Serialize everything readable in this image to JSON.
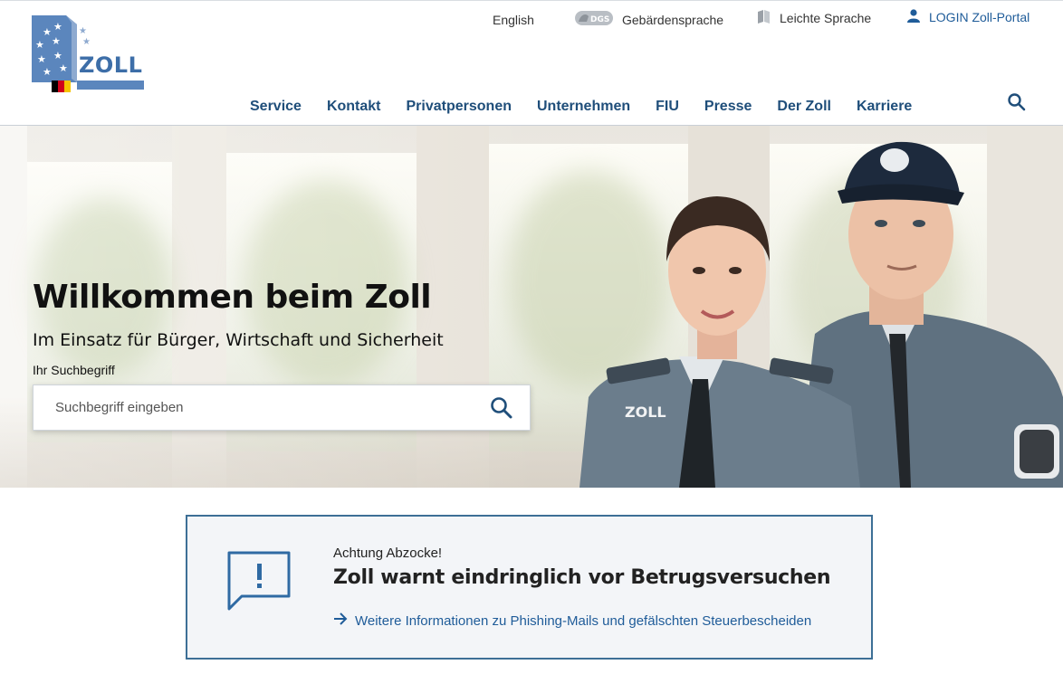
{
  "header": {
    "logo_text": "ZOLL",
    "meta": {
      "language": "English",
      "sign_language_badge": "DGS",
      "sign_language": "Gebärdensprache",
      "easy_language": "Leichte Sprache",
      "login": "LOGIN Zoll-Portal"
    },
    "nav": [
      "Service",
      "Kontakt",
      "Privatpersonen",
      "Unternehmen",
      "FIU",
      "Presse",
      "Der Zoll",
      "Karriere"
    ],
    "colors": {
      "brand_blue": "#3d6ea8",
      "nav_text": "#1f4e7a",
      "link": "#1f5c99"
    }
  },
  "hero": {
    "title": "Willkommen beim Zoll",
    "subtitle": "Im Einsatz für Bürger, Wirtschaft und Sicherheit",
    "search_label": "Ihr Suchbegriff",
    "search_placeholder": "Suchbegriff eingeben",
    "badge_text": "ZOLL"
  },
  "alert": {
    "kicker": "Achtung Abzocke!",
    "title": "Zoll warnt eindringlich vor Betrugsversuchen",
    "link": "Weitere Informationen zu Phishing-Mails und gefälschten Steuerbescheiden",
    "border_color": "#3d6f96"
  }
}
